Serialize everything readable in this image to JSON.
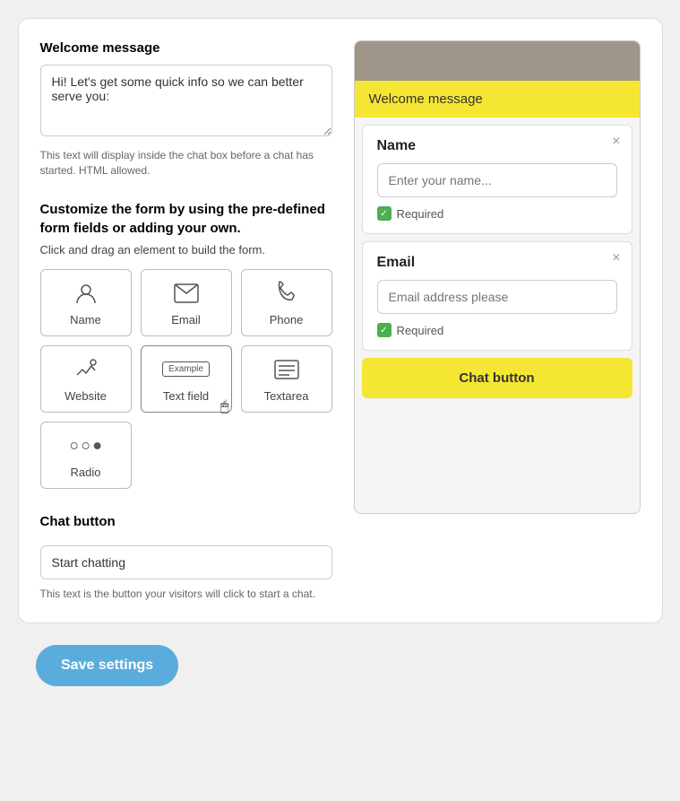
{
  "left": {
    "welcome_title": "Welcome message",
    "welcome_textarea_value": "Hi! Let's get some quick info so we can better serve you:",
    "welcome_hint": "This text will display inside the chat box before a chat has started. HTML allowed.",
    "customize_title": "Customize the form by using the pre-defined form fields or adding your own.",
    "customize_hint": "Click and drag an element to build the form.",
    "form_elements": [
      {
        "label": "Name",
        "icon": "name"
      },
      {
        "label": "Email",
        "icon": "email"
      },
      {
        "label": "Phone",
        "icon": "phone"
      },
      {
        "label": "Website",
        "icon": "website"
      },
      {
        "label": "Text field",
        "icon": "textfield"
      },
      {
        "label": "Textarea",
        "icon": "textarea"
      },
      {
        "label": "Radio",
        "icon": "radio"
      }
    ],
    "chat_button_section_title": "Chat button",
    "chat_button_input_value": "Start chatting",
    "chat_button_hint": "This text is the button your visitors will click to start a chat."
  },
  "right": {
    "preview_header": "",
    "welcome_message": "Welcome message",
    "name_field": {
      "title": "Name",
      "placeholder": "Enter your name...",
      "required_label": "Required"
    },
    "email_field": {
      "title": "Email",
      "placeholder": "Email address please",
      "required_label": "Required"
    },
    "chat_button_label": "Chat button"
  },
  "save_button_label": "Save settings"
}
